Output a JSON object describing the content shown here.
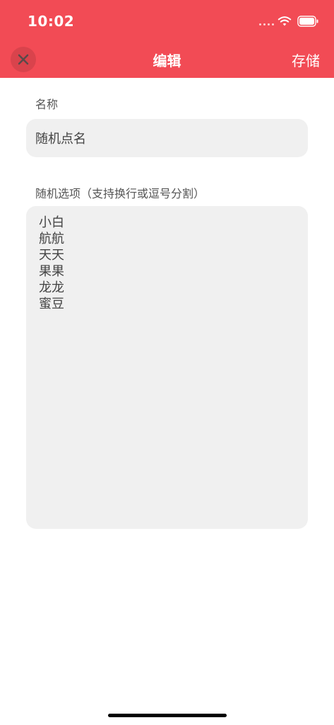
{
  "status_bar": {
    "time": "10:02"
  },
  "nav_bar": {
    "title": "编辑",
    "save_label": "存储",
    "close_icon": "close-icon"
  },
  "form": {
    "name_label": "名称",
    "name_value": "随机点名",
    "options_label": "随机选项（支持换行或逗号分割）",
    "options_value": "小白\n航航\n天天\n果果\n龙龙\n蜜豆"
  },
  "colors": {
    "header": "#f24b55",
    "field_background": "#f0f0f0"
  }
}
